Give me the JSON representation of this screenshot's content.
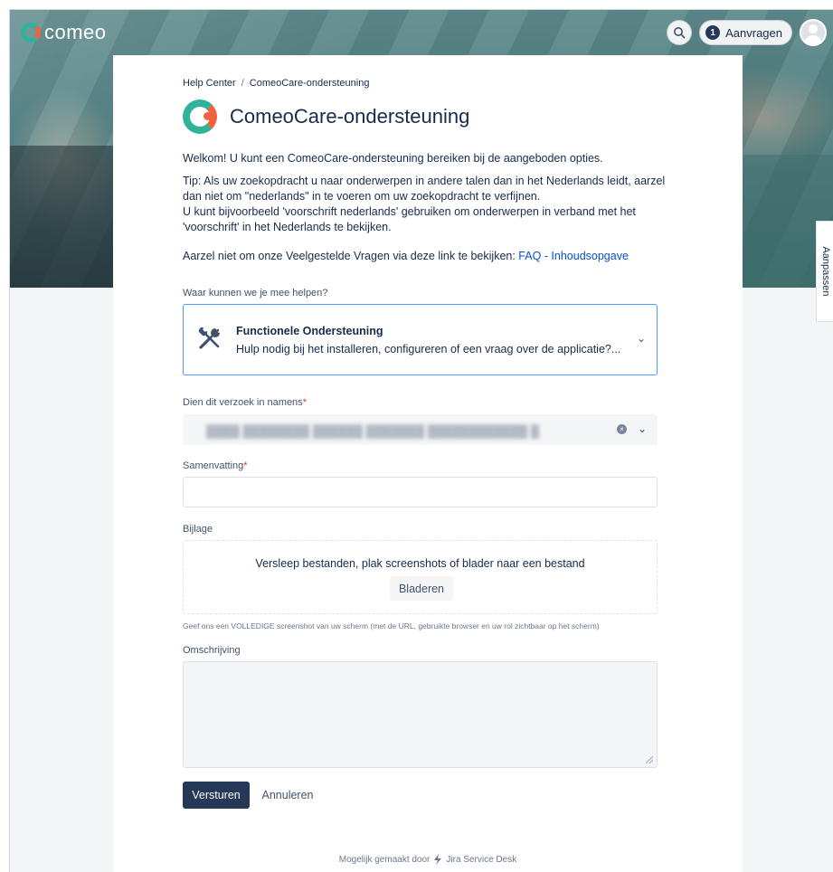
{
  "brand": {
    "logo_text": "comeo",
    "accent": "#2fb39a",
    "accent2": "#f0613f"
  },
  "topbar": {
    "search_icon": "search-icon",
    "requests_count": "1",
    "requests_label": "Aanvragen",
    "avatar_icon": "user-avatar-icon"
  },
  "side_tab": {
    "label": "Aanpassen"
  },
  "breadcrumb": {
    "root": "Help Center",
    "separator": "/",
    "current": "ComeoCare-ondersteuning"
  },
  "page": {
    "title": "ComeoCare-ondersteuning",
    "welcome": "Welkom! U kunt een ComeoCare-ondersteuning bereiken bij de aangeboden opties.",
    "tip_line1": "Tip: Als uw zoekopdracht u naar onderwerpen in andere talen dan in het Nederlands leidt, aarzel",
    "tip_line2": "dan niet om \"nederlands\" in te voeren om uw zoekopdracht te verfijnen.",
    "tip_line3": "U kunt bijvoorbeeld 'voorschrift nederlands' gebruiken om onderwerpen in verband met het",
    "tip_line4": "'voorschrift' in het Nederlands te bekijken.",
    "faq_prefix": "Aarzel niet om onze Veelgestelde Vragen via deze link te bekijken: ",
    "faq_link": "FAQ - Inhoudsopgave"
  },
  "form": {
    "help_question": "Waar kunnen we je mee helpen?",
    "request_type": {
      "title": "Functionele Ondersteuning",
      "description": "Hulp nodig bij het installeren, configureren of een vraag over de applicatie?..."
    },
    "on_behalf_label": "Dien dit verzoek in namens",
    "on_behalf_value": "████ ████████ ██████ ███████ ████████████ █",
    "summary_label": "Samenvatting",
    "required_mark": "*",
    "attachment_label": "Bijlage",
    "dropzone_text": "Versleep bestanden, plak screenshots of blader naar een bestand",
    "browse_label": "Bladeren",
    "attachment_help": "Geef ons een VOLLEDIGE screenshot van uw scherm (met de URL, gebruikte browser en uw rol zichtbaar op het scherm)",
    "description_label": "Omschrijving",
    "submit_label": "Versturen",
    "cancel_label": "Annuleren"
  },
  "footer": {
    "prefix": "Mogelijk gemaakt door",
    "product": "Jira Service Desk"
  }
}
